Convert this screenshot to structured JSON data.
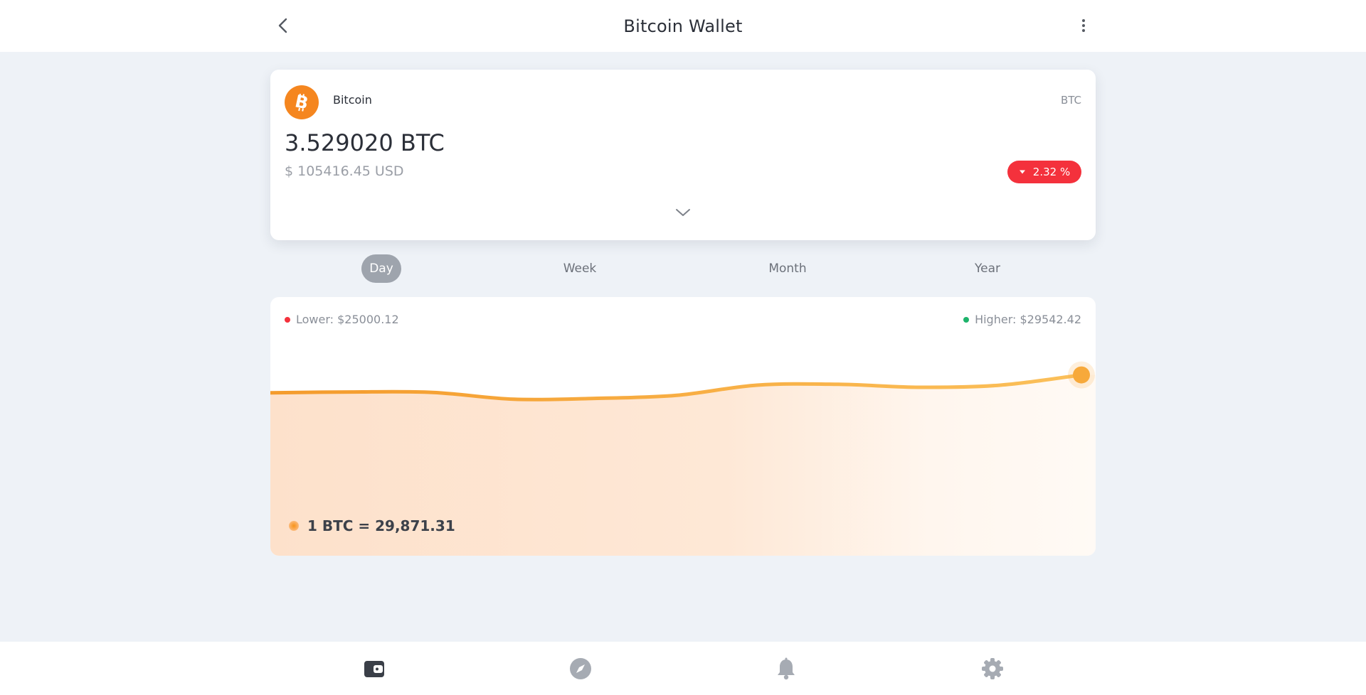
{
  "header": {
    "title": "Bitcoin Wallet",
    "back_icon": "chevron-left-icon",
    "menu_icon": "more-vertical-icon"
  },
  "wallet": {
    "coin_name": "Bitcoin",
    "coin_symbol": "BTC",
    "coin_icon": "bitcoin-icon",
    "balance": "3.529020 BTC",
    "balance_usd": "$ 105416.45 USD",
    "change": "2.32 %",
    "change_direction": "down",
    "expand_icon": "chevron-down-icon"
  },
  "tabs": [
    {
      "label": "Day",
      "active": true
    },
    {
      "label": "Week",
      "active": false
    },
    {
      "label": "Month",
      "active": false
    },
    {
      "label": "Year",
      "active": false
    }
  ],
  "chart": {
    "lower_label": "Lower: $25000.12",
    "higher_label": "Higher: $29542.42",
    "rate": "1 BTC = 29,871.31"
  },
  "chart_data": {
    "type": "area",
    "series": [
      {
        "values": [
          0.42,
          0.44,
          0.43,
          0.27,
          0.29,
          0.36,
          0.6,
          0.62,
          0.55,
          0.6,
          0.84
        ]
      }
    ],
    "note_levels": "relative line level 0..1 (no printed axis)"
  },
  "bottom_nav": [
    {
      "icon": "wallet-icon",
      "active": true
    },
    {
      "icon": "compass-icon",
      "active": false
    },
    {
      "icon": "bell-icon",
      "active": false
    },
    {
      "icon": "gear-icon",
      "active": false
    }
  ],
  "colors": {
    "accent": "#f5861f",
    "negative": "#f4313c",
    "positive": "#1db36b",
    "line": "#f7a93b",
    "background": "#eef2f7"
  }
}
